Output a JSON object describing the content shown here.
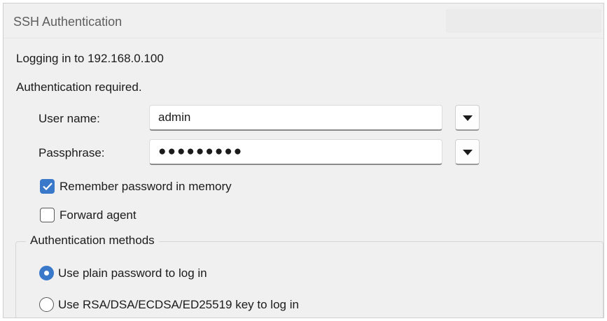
{
  "dialog": {
    "title": "SSH Authentication",
    "login_target": "Logging in to 192.168.0.100",
    "auth_required": "Authentication required."
  },
  "form": {
    "username_label": "User name:",
    "username_value": "admin",
    "passphrase_label": "Passphrase:",
    "passphrase_value": "●●●●●●●●●",
    "dropdown_icon": "chevron-down-icon"
  },
  "options": {
    "remember_password": {
      "label": "Remember password in memory",
      "checked": true
    },
    "forward_agent": {
      "label": "Forward agent",
      "checked": false
    }
  },
  "auth_methods": {
    "legend": "Authentication methods",
    "items": [
      {
        "label": "Use plain password to log in",
        "selected": true
      },
      {
        "label": "Use RSA/DSA/ECDSA/ED25519 key to log in",
        "selected": false
      }
    ]
  },
  "colors": {
    "accent": "#3a78c9",
    "background": "#f0f0f0",
    "field": "#ffffff"
  }
}
